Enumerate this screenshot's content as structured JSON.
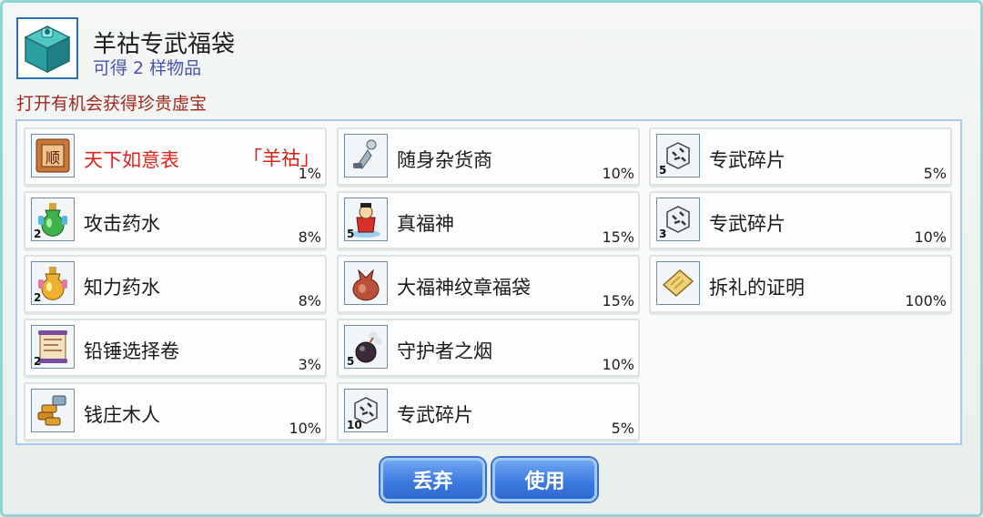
{
  "header": {
    "title": "羊祜专武福袋",
    "subtitle": "可得 2 样物品",
    "description": "打开有机会获得珍贵虚宝",
    "icon": "teal-gift-box-icon"
  },
  "items": [
    {
      "name": "天下如意表",
      "tag": "「羊祜」",
      "qty": "",
      "pct": "1%",
      "icon": "watch-scroll-icon"
    },
    {
      "name": "攻击药水",
      "tag": "",
      "qty": "2",
      "pct": "8%",
      "icon": "green-potion-icon"
    },
    {
      "name": "知力药水",
      "tag": "",
      "qty": "2",
      "pct": "8%",
      "icon": "yellow-potion-icon"
    },
    {
      "name": "铅锤选择卷",
      "tag": "",
      "qty": "2",
      "pct": "3%",
      "icon": "scroll-icon"
    },
    {
      "name": "钱庄木人",
      "tag": "",
      "qty": "",
      "pct": "10%",
      "icon": "gold-puppet-icon"
    },
    {
      "name": "随身杂货商",
      "tag": "",
      "qty": "",
      "pct": "10%",
      "icon": "merchant-figure-icon"
    },
    {
      "name": "真福神",
      "tag": "",
      "qty": "5",
      "pct": "15%",
      "icon": "fortune-god-icon"
    },
    {
      "name": "大福神纹章福袋",
      "tag": "",
      "qty": "",
      "pct": "15%",
      "icon": "lucky-bag-icon"
    },
    {
      "name": "守护者之烟",
      "tag": "",
      "qty": "5",
      "pct": "10%",
      "icon": "smoke-bomb-icon"
    },
    {
      "name": "专武碎片",
      "tag": "",
      "qty": "10",
      "pct": "5%",
      "icon": "fragment-icon"
    },
    {
      "name": "专武碎片",
      "tag": "",
      "qty": "5",
      "pct": "5%",
      "icon": "fragment-icon"
    },
    {
      "name": "专武碎片",
      "tag": "",
      "qty": "3",
      "pct": "10%",
      "icon": "fragment-icon"
    },
    {
      "name": "拆礼的证明",
      "tag": "",
      "qty": "",
      "pct": "100%",
      "icon": "gold-ticket-icon"
    }
  ],
  "buttons": {
    "discard": "丢弃",
    "use": "使用"
  },
  "colors": {
    "accent": "#3d7be0",
    "highlight_name": "#e0231b",
    "description": "#a02a1f",
    "subtitle": "#4a52b0"
  }
}
